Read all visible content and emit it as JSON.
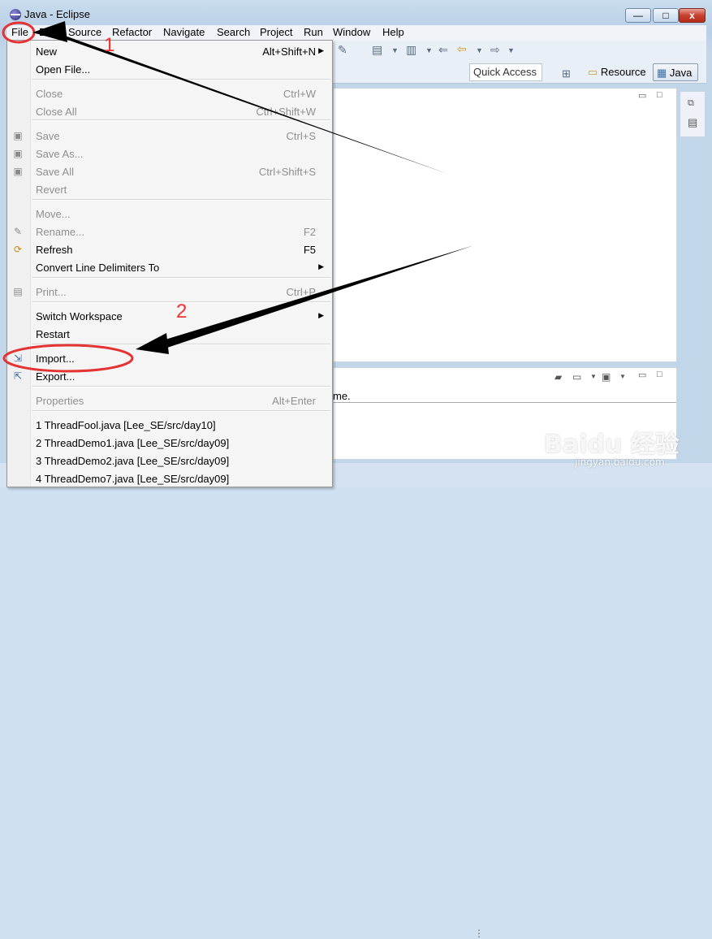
{
  "window": {
    "title": "Java - Eclipse",
    "controls": {
      "minimize": "—",
      "maximize": "□",
      "close": "x"
    }
  },
  "menubar": {
    "items": [
      "File",
      "Edit",
      "Source",
      "Refactor",
      "Navigate",
      "Search",
      "Project",
      "Run",
      "Window",
      "Help"
    ]
  },
  "toolbar": {
    "quick_access": "Quick Access",
    "perspectives": {
      "resource": "Resource",
      "java": "Java"
    }
  },
  "file_menu": {
    "items": [
      {
        "label": "New",
        "accel": "Alt+Shift+N",
        "submenu": true,
        "disabled": false,
        "icon": ""
      },
      {
        "label": "Open File...",
        "accel": "",
        "submenu": false,
        "disabled": false,
        "icon": ""
      },
      {
        "label": "Close",
        "accel": "Ctrl+W",
        "submenu": false,
        "disabled": true,
        "icon": ""
      },
      {
        "label": "Close All",
        "accel": "Ctrl+Shift+W",
        "submenu": false,
        "disabled": true,
        "icon": ""
      },
      {
        "label": "Save",
        "accel": "Ctrl+S",
        "submenu": false,
        "disabled": true,
        "icon": "save-icon"
      },
      {
        "label": "Save As...",
        "accel": "",
        "submenu": false,
        "disabled": true,
        "icon": "save-as-icon"
      },
      {
        "label": "Save All",
        "accel": "Ctrl+Shift+S",
        "submenu": false,
        "disabled": true,
        "icon": "save-all-icon"
      },
      {
        "label": "Revert",
        "accel": "",
        "submenu": false,
        "disabled": true,
        "icon": ""
      },
      {
        "label": "Move...",
        "accel": "",
        "submenu": false,
        "disabled": true,
        "icon": ""
      },
      {
        "label": "Rename...",
        "accel": "F2",
        "submenu": false,
        "disabled": true,
        "icon": "rename-icon"
      },
      {
        "label": "Refresh",
        "accel": "F5",
        "submenu": false,
        "disabled": false,
        "icon": "refresh-icon"
      },
      {
        "label": "Convert Line Delimiters To",
        "accel": "",
        "submenu": true,
        "disabled": false,
        "icon": ""
      },
      {
        "label": "Print...",
        "accel": "Ctrl+P",
        "submenu": false,
        "disabled": true,
        "icon": "print-icon"
      },
      {
        "label": "Switch Workspace",
        "accel": "",
        "submenu": true,
        "disabled": false,
        "icon": ""
      },
      {
        "label": "Restart",
        "accel": "",
        "submenu": false,
        "disabled": false,
        "icon": ""
      },
      {
        "label": "Import...",
        "accel": "",
        "submenu": false,
        "disabled": false,
        "icon": "import-icon"
      },
      {
        "label": "Export...",
        "accel": "",
        "submenu": false,
        "disabled": false,
        "icon": "export-icon"
      },
      {
        "label": "Properties",
        "accel": "Alt+Enter",
        "submenu": false,
        "disabled": true,
        "icon": ""
      },
      {
        "label": "1 ThreadFool.java  [Lee_SE/src/day10]",
        "accel": "",
        "submenu": false,
        "disabled": false,
        "icon": ""
      },
      {
        "label": "2 ThreadDemo1.java  [Lee_SE/src/day09]",
        "accel": "",
        "submenu": false,
        "disabled": false,
        "icon": ""
      },
      {
        "label": "3 ThreadDemo2.java  [Lee_SE/src/day09]",
        "accel": "",
        "submenu": false,
        "disabled": false,
        "icon": ""
      },
      {
        "label": "4 ThreadDemo7.java  [Lee_SE/src/day09]",
        "accel": "",
        "submenu": false,
        "disabled": false,
        "icon": ""
      }
    ]
  },
  "bottom_panel": {
    "partial_text": "me."
  },
  "annotations": {
    "step1": "1",
    "step2": "2"
  },
  "watermark": {
    "main": "Baidu 经验",
    "sub": "jingyan.baidu.com"
  },
  "colors": {
    "annotation": "#e33333",
    "arrow": "#000000"
  }
}
